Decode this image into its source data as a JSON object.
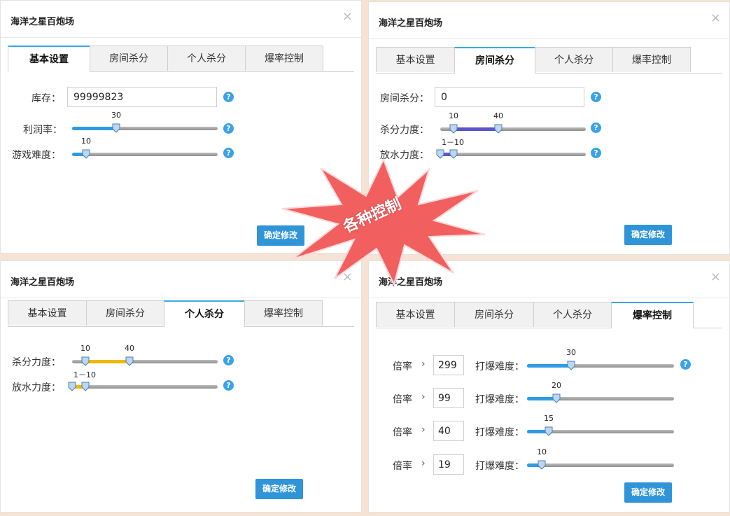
{
  "window_title": "海洋之星百炮场",
  "close_glyph": "×",
  "help_glyph": "?",
  "tabs": [
    "基本设置",
    "房间杀分",
    "个人杀分",
    "爆率控制"
  ],
  "confirm_label": "确定修改",
  "panel1": {
    "stock_label": "库存：",
    "stock_value": "99999823",
    "profit_label": "利润率：",
    "profit_value": "30",
    "difficulty_label": "游戏难度：",
    "difficulty_value": "10"
  },
  "panel2": {
    "room_kill_label": "房间杀分：",
    "room_kill_value": "0",
    "kill_force_label": "杀分力度：",
    "kill_force_low": "10",
    "kill_force_high": "40",
    "release_label": "放水力度：",
    "release_value": "1－10"
  },
  "panel3": {
    "kill_force_label": "杀分力度：",
    "kill_force_low": "10",
    "kill_force_high": "40",
    "release_label": "放水力度：",
    "release_value": "1－10"
  },
  "panel4": {
    "rate_label": "倍率",
    "chevron": "›",
    "burst_label": "打爆难度：",
    "rows": [
      {
        "rate": "299",
        "difficulty": "30"
      },
      {
        "rate": "99",
        "difficulty": "20"
      },
      {
        "rate": "40",
        "difficulty": "15"
      },
      {
        "rate": "19",
        "difficulty": "10"
      }
    ]
  },
  "banner_text": "各种控制",
  "colors": {
    "accent": "#39a9e6",
    "slider_blue": "#2e9be3",
    "slider_purple": "#5a55c8",
    "slider_yellow": "#f2b705",
    "button": "#2f95d8",
    "starburst": "#f25f5f"
  }
}
